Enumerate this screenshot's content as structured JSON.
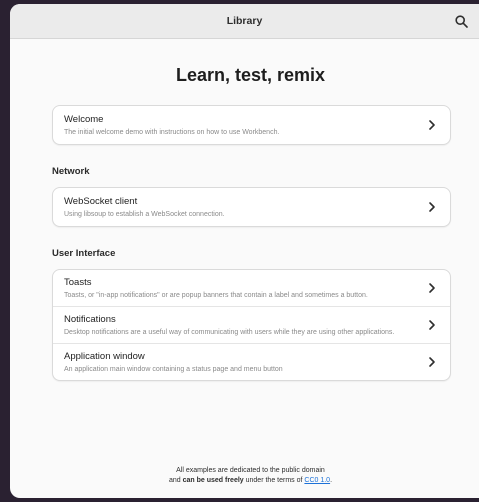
{
  "header": {
    "title": "Library"
  },
  "hero": {
    "title": "Learn, test, remix"
  },
  "sections": {
    "intro": {
      "items": [
        {
          "title": "Welcome",
          "subtitle": "The initial welcome demo with instructions on how to use Workbench."
        }
      ]
    },
    "network": {
      "heading": "Network",
      "items": [
        {
          "title": "WebSocket client",
          "subtitle": "Using libsoup to establish a WebSocket connection."
        }
      ]
    },
    "ui": {
      "heading": "User Interface",
      "items": [
        {
          "title": "Toasts",
          "subtitle": "Toasts, or \"in-app notifications\" or are popup banners that contain a label and sometimes a button."
        },
        {
          "title": "Notifications",
          "subtitle": "Desktop notifications are a useful way of communicating with users while they are using other applications."
        },
        {
          "title": "Application window",
          "subtitle": "An application main window containing a status page and menu button"
        }
      ]
    }
  },
  "footer": {
    "line1": "All examples are dedicated to the public domain",
    "line2_prefix": "and ",
    "line2_bold": "can be used freely",
    "line2_middle": " under the terms of ",
    "link": "CC0 1.0",
    "line2_suffix": "."
  },
  "icons": {
    "search": "search-icon",
    "chevron": "chevron-right-icon"
  },
  "colors": {
    "background": "#2a2131",
    "window": "#fafafa",
    "link": "#1c71d8"
  }
}
